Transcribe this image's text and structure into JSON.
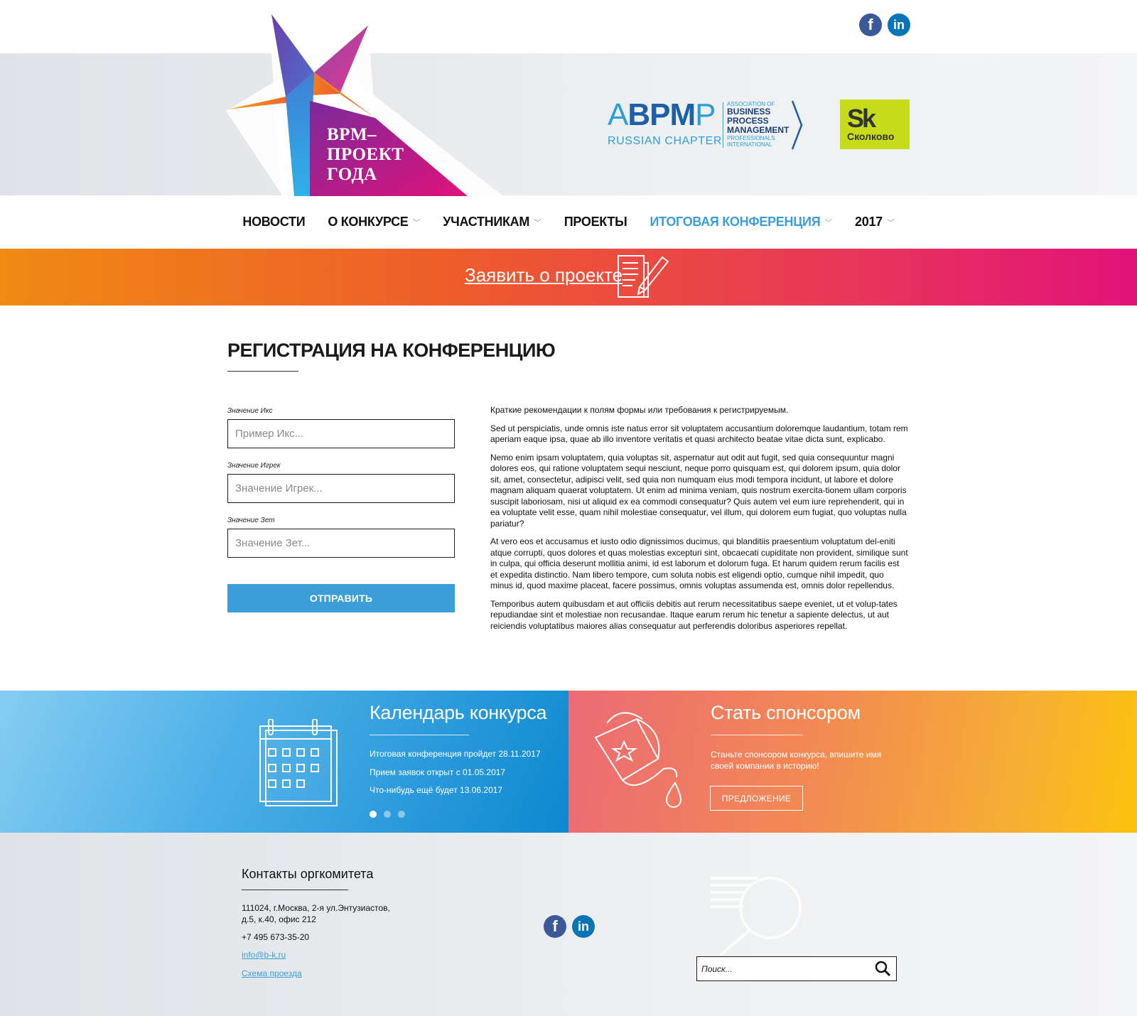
{
  "header": {
    "logo_lines": [
      "BPM–",
      "ПРОЕКТ",
      "ГОДА"
    ],
    "partner_abpmp": {
      "main_lite_a": "A",
      "main_bold": "BPM",
      "main_lite_p": "P",
      "sub": "RUSSIAN CHAPTER",
      "right_small_top": "ASSOCIATION OF",
      "right_lines": [
        "BUSINESS",
        "PROCESS",
        "MANAGEMENT"
      ],
      "right_small_bottom": [
        "PROFESSIONALS",
        "INTERNATIONAL"
      ]
    },
    "partner_sk": {
      "big": "Sk",
      "small": "Сколково"
    },
    "social": {
      "facebook_icon": "facebook-icon",
      "linkedin_icon": "linkedin-icon"
    }
  },
  "nav": {
    "items": [
      {
        "label": "НОВОСТИ"
      },
      {
        "label": "О КОНКУРСЕ"
      },
      {
        "label": "УЧАСТНИКАМ"
      },
      {
        "label": "ПРОЕКТЫ"
      },
      {
        "label": "ИТОГОВАЯ КОНФЕРЕНЦИЯ"
      },
      {
        "label": "2017"
      }
    ],
    "active_color": "#3c9ed9"
  },
  "banner": {
    "link": "Заявить о проекте",
    "icon": "document-pen-icon"
  },
  "page": {
    "title": "РЕГИСТРАЦИЯ НА КОНФЕРЕНЦИЮ"
  },
  "form": {
    "fields": [
      {
        "label": "Значение Икс",
        "placeholder": "Пример Икс..."
      },
      {
        "label": "Значение Игрек",
        "placeholder": "Значение Игрек..."
      },
      {
        "label": "Значение Зет",
        "placeholder": "Значение Зет..."
      }
    ],
    "submit_label": "ОТПРАВИТЬ"
  },
  "content": {
    "paragraphs": [
      "Краткие рекомендации к полям формы или требования к регистрируемым.",
      "Sed ut perspiciatis, unde omnis iste natus error sit voluptatem accusantium doloremque laudantium, totam rem aperiam eaque ipsa, quae ab illo inventore veritatis et quasi architecto beatae vitae dicta sunt, explicabo.",
      "Nemo enim ipsam voluptatem, quia voluptas sit, aspernatur aut odit aut fugit, sed quia consequuntur magni dolores eos, qui ratione voluptatem sequi nesciunt, neque porro quisquam est, qui dolorem ipsum, quia dolor sit, amet, consectetur, adipisci velit, sed quia non numquam eius modi tempora incidunt, ut labore et dolore magnam aliquam quaerat voluptatem. Ut enim ad minima veniam, quis nostrum exercita-tionem ullam corporis suscipit laboriosam, nisi ut aliquid ex ea commodi consequatur? Quis autem vel eum iure reprehenderit, qui in ea voluptate velit esse, quam nihil molestiae consequatur, vel illum, qui dolorem eum fugiat, quo voluptas nulla pariatur?",
      "At vero eos et accusamus et iusto odio dignissimos ducimus, qui blanditiis praesentium voluptatum del-eniti atque corrupti, quos dolores et quas molestias excepturi sint, obcaecati cupiditate non provident, similique sunt in culpa, qui officia deserunt mollitia animi, id est laborum et dolorum fuga. Et harum quidem rerum facilis est et expedita distinctio. Nam libero tempore, cum soluta nobis est eligendi optio, cumque nihil impedit, quo minus id, quod maxime placeat, facere possimus, omnis voluptas assumenda est, omnis dolor repellendus.",
      "Temporibus autem quibusdam et aut officiis debitis aut rerum necessitatibus saepe eveniet, ut et volup-tates repudiandae sint et molestiae non recusandae. Itaque earum rerum hic tenetur a sapiente delectus, ut aut reiciendis voluptatibus maiores alias consequatur aut perferendis doloribus asperiores repellat."
    ]
  },
  "calendar": {
    "title": "Календарь конкурса",
    "icon": "calendar-icon",
    "lines": [
      "Итоговая конференция пройдет 28.11.2017",
      "Прием заявок открыт с 01.05.2017",
      "Что-нибудь ещё будет 13.06.2017"
    ],
    "slides": 3,
    "active_slide": 1
  },
  "sponsor": {
    "title": "Стать спонсором",
    "icon": "paint-bucket-star-icon",
    "text": "Станьте спонсором конкурса, впишите имя своей компании в историю!",
    "button": "ПРЕДЛОЖЕНИЕ"
  },
  "footer": {
    "title": "Контакты оргкомитета",
    "address_line1": "111024, г.Москва, 2-я ул.Энтузиастов,",
    "address_line2": "д.5, к.40, офис 212",
    "phone": "+7 495 673-35-20",
    "email": "info@b-k.ru",
    "map_link": "Схема проезда",
    "search_placeholder": "Поиск...",
    "search_icon": "search-icon"
  },
  "colors": {
    "accent_blue": "#3c9ed9",
    "banner_start": "#f08a13",
    "banner_end": "#e2127a",
    "sk_green": "#c8dc1c"
  }
}
